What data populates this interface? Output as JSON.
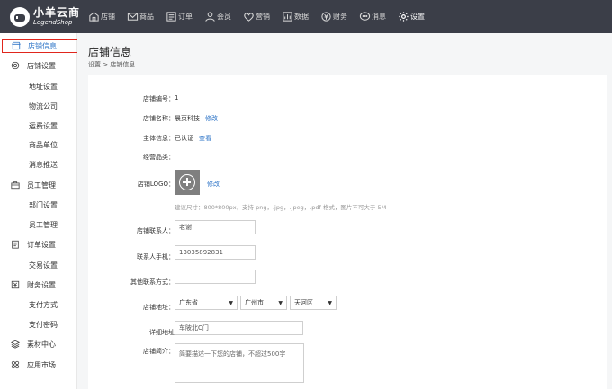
{
  "brand": {
    "name_cn": "小羊云商",
    "name_en": "LegendShop"
  },
  "nav": [
    {
      "label": "店铺",
      "icon": "shop-icon"
    },
    {
      "label": "商品",
      "icon": "mail-icon"
    },
    {
      "label": "订单",
      "icon": "document-icon"
    },
    {
      "label": "会员",
      "icon": "user-icon"
    },
    {
      "label": "营销",
      "icon": "heart-icon"
    },
    {
      "label": "数据",
      "icon": "chart-icon"
    },
    {
      "label": "财务",
      "icon": "money-icon"
    },
    {
      "label": "消息",
      "icon": "chat-icon"
    },
    {
      "label": "设置",
      "icon": "gear-icon",
      "active": true
    }
  ],
  "sidebar": {
    "items": [
      {
        "label": "店铺信息",
        "type": "active"
      },
      {
        "label": "店铺设置",
        "type": "group",
        "icon": "gear-icon"
      },
      {
        "label": "地址设置",
        "type": "sub"
      },
      {
        "label": "物流公司",
        "type": "sub"
      },
      {
        "label": "运费设置",
        "type": "sub"
      },
      {
        "label": "商品单位",
        "type": "sub"
      },
      {
        "label": "消息推送",
        "type": "sub"
      },
      {
        "label": "员工管理",
        "type": "group",
        "icon": "briefcase-icon"
      },
      {
        "label": "部门设置",
        "type": "sub"
      },
      {
        "label": "员工管理",
        "type": "sub"
      },
      {
        "label": "订单设置",
        "type": "group",
        "icon": "clipboard-icon"
      },
      {
        "label": "交易设置",
        "type": "sub"
      },
      {
        "label": "财务设置",
        "type": "group",
        "icon": "yen-icon"
      },
      {
        "label": "支付方式",
        "type": "sub"
      },
      {
        "label": "支付密码",
        "type": "sub"
      },
      {
        "label": "素材中心",
        "type": "group",
        "icon": "layers-icon"
      },
      {
        "label": "应用市场",
        "type": "group",
        "icon": "apps-icon"
      }
    ]
  },
  "page": {
    "title": "店铺信息",
    "breadcrumb": "设置 > 店铺信息"
  },
  "form": {
    "shop_no_label": "店铺编号：",
    "shop_no": "1",
    "shop_name_label": "店铺名称：",
    "shop_name": "晨页科技",
    "edit_label": "修改",
    "subject_label": "主体信息：",
    "subject": "已认证",
    "view_label": "查看",
    "category_label": "经营品类：",
    "logo_label": "店铺LOGO：",
    "logo_edit_label": "修改",
    "logo_hint": "建议尺寸：800*800px，支持 png，.jpg，.jpeg，.pdf 格式，图片不可大于 5M",
    "contact_label": "店铺联系人：",
    "contact": "老谢",
    "phone_label": "联系人手机：",
    "phone": "13035892831",
    "other_label": "其他联系方式：",
    "other": "",
    "address_label": "店铺地址：",
    "province": "广东省",
    "city": "广州市",
    "district": "天河区",
    "detail_label": "详细地址",
    "detail": "车陂北C门",
    "intro_label": "店铺简介：",
    "intro_placeholder": "简要描述一下您的店铺，不超过500字"
  }
}
